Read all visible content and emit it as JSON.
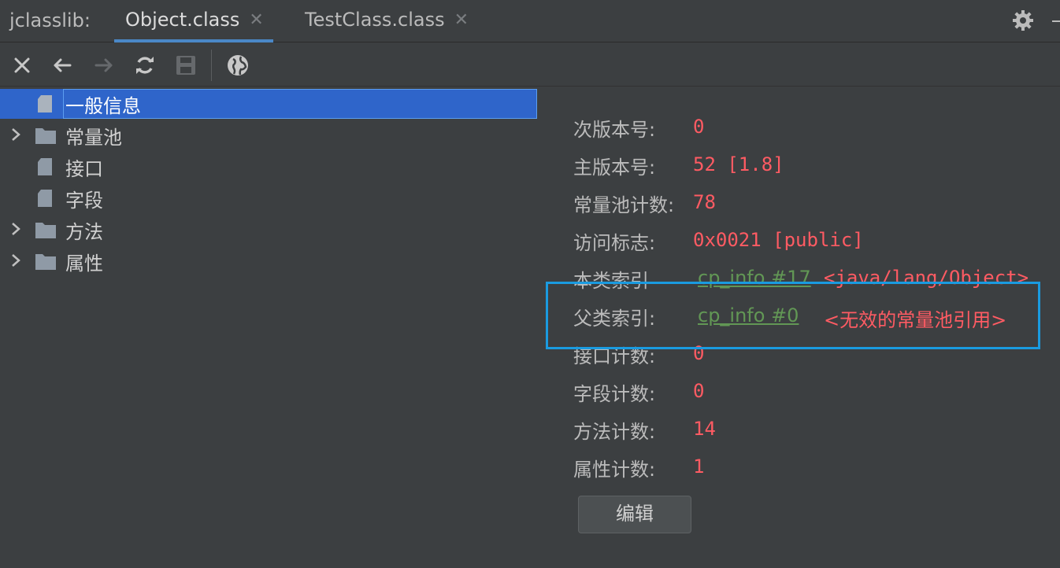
{
  "tabbar": {
    "prefix": "jclasslib:",
    "tabs": [
      {
        "label": "Object.class",
        "active": true
      },
      {
        "label": "TestClass.class",
        "active": false
      }
    ],
    "close_glyph": "✕"
  },
  "toolbar": {
    "buttons": [
      "close-icon",
      "back-arrow-icon",
      "forward-arrow-icon",
      "refresh-icon",
      "save-icon",
      "globe-icon"
    ]
  },
  "tree": {
    "items": [
      {
        "label": "一般信息",
        "type": "file",
        "expandable": false,
        "selected": true
      },
      {
        "label": "常量池",
        "type": "folder",
        "expandable": true,
        "selected": false
      },
      {
        "label": "接口",
        "type": "file",
        "expandable": false,
        "selected": false
      },
      {
        "label": "字段",
        "type": "file",
        "expandable": false,
        "selected": false
      },
      {
        "label": "方法",
        "type": "folder",
        "expandable": true,
        "selected": false
      },
      {
        "label": "属性",
        "type": "folder",
        "expandable": true,
        "selected": false
      }
    ]
  },
  "details": {
    "minor_version": {
      "label": "次版本号:",
      "value": "0"
    },
    "major_version": {
      "label": "主版本号:",
      "value": "52 [1.8]"
    },
    "constant_pool_count": {
      "label": "常量池计数:",
      "value": "78"
    },
    "access_flags": {
      "label": "访问标志:",
      "value": "0x0021 [public]"
    },
    "this_class": {
      "label": "本类索引",
      "link": "cp_info #17",
      "extra": "<java/lang/Object>"
    },
    "super_class": {
      "label": "父类索引:",
      "link": "cp_info #0",
      "extra": "<无效的常量池引用>"
    },
    "interfaces_count": {
      "label": "接口计数:",
      "value": "0"
    },
    "fields_count": {
      "label": "字段计数:",
      "value": "0"
    },
    "methods_count": {
      "label": "方法计数:",
      "value": "14"
    },
    "attributes_count": {
      "label": "属性计数:",
      "value": "1"
    },
    "edit_button": "编辑"
  },
  "colors": {
    "background": "#3c3f41",
    "selection": "#2f65ca",
    "value_red": "#ff5b63",
    "link_green": "#629755",
    "highlight_box": "#1a9be0",
    "tab_underline": "#4a88c7"
  }
}
